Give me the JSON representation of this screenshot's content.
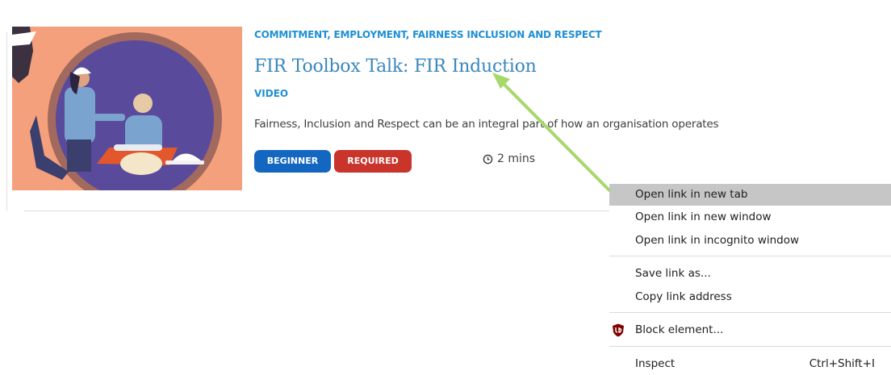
{
  "card": {
    "categories": "COMMITMENT, EMPLOYMENT, FAIRNESS INCLUSION AND RESPECT",
    "title": "FIR Toolbox Talk: FIR Induction",
    "type": "VIDEO",
    "description": "Fairness, Inclusion and Respect can be an integral part of how an organisation operates",
    "badges": [
      {
        "label": "BEGINNER",
        "color": "#1467c0"
      },
      {
        "label": "REQUIRED",
        "color": "#c9342b"
      }
    ],
    "duration": "2 mins",
    "duration_icon": "clock-icon"
  },
  "context_menu": {
    "items": [
      {
        "label": "Open link in new tab",
        "highlighted": true
      },
      {
        "label": "Open link in new window"
      },
      {
        "label": "Open link in incognito window"
      },
      {
        "label": "Save link as..."
      },
      {
        "label": "Copy link address"
      },
      {
        "label": "Block element...",
        "icon": "ublock-origin-icon"
      },
      {
        "label": "Inspect",
        "shortcut": "Ctrl+Shift+I"
      }
    ]
  },
  "annotation": {
    "arrow_color": "#a6d86a"
  },
  "colors": {
    "accent_blue": "#1f8fd3",
    "title_blue": "#3a87bd",
    "menu_highlight": "#c6c6c6"
  }
}
